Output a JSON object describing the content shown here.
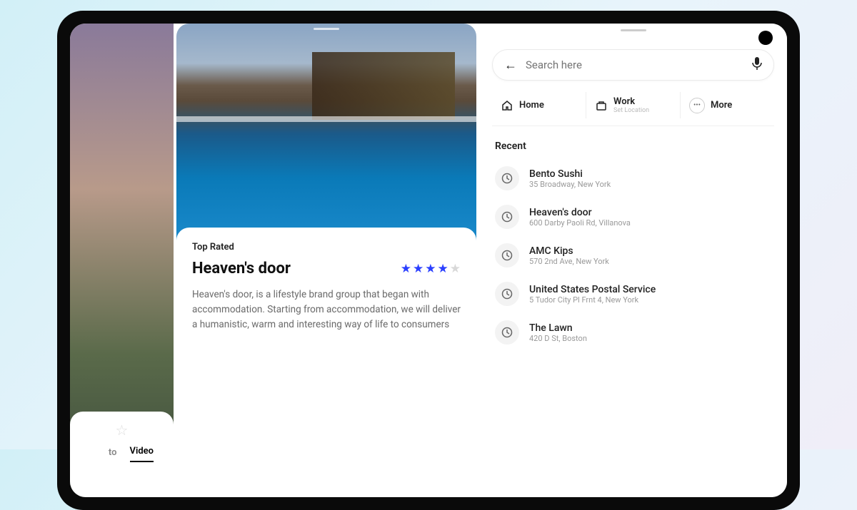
{
  "left_pane": {
    "tabs": [
      {
        "label": "to"
      },
      {
        "label": "Video"
      }
    ]
  },
  "mid_pane": {
    "badge": "Top Rated",
    "title": "Heaven's door",
    "rating": 4,
    "rating_max": 5,
    "description": "Heaven's door, is a lifestyle brand group that began with accommodation. Starting from accommodation, we will deliver a humanistic, warm and interesting way of life to consumers"
  },
  "right_pane": {
    "search": {
      "placeholder": "Search here"
    },
    "shortcuts": [
      {
        "icon": "home",
        "label": "Home",
        "sub": ""
      },
      {
        "icon": "briefcase",
        "label": "Work",
        "sub": "Set Location"
      },
      {
        "icon": "more",
        "label": "More",
        "sub": ""
      }
    ],
    "recent_header": "Recent",
    "recent": [
      {
        "title": "Bento Sushi",
        "sub": "35 Broadway, New York"
      },
      {
        "title": "Heaven's door",
        "sub": "600 Darby Paoli Rd, Villanova"
      },
      {
        "title": "AMC Kips",
        "sub": "570 2nd Ave, New York"
      },
      {
        "title": "United States Postal Service",
        "sub": "5 Tudor City Pl Frnt 4, New York"
      },
      {
        "title": "The Lawn",
        "sub": "420 D St, Boston"
      }
    ]
  }
}
